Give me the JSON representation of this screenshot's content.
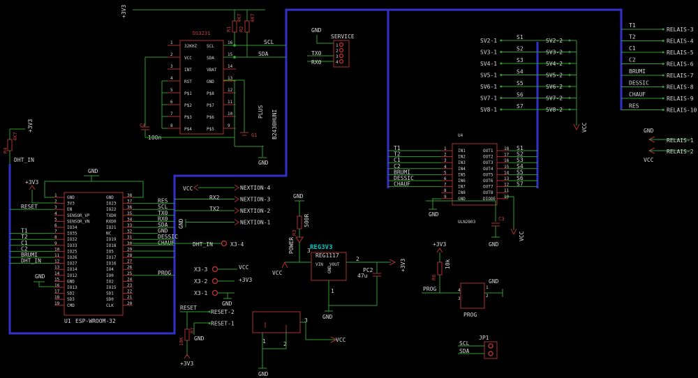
{
  "ds3231": {
    "ref": "DS3231",
    "left_pins": [
      {
        "num": "1",
        "name": "32KHZ"
      },
      {
        "num": "2",
        "name": "VCC"
      },
      {
        "num": "3",
        "name": "INT"
      },
      {
        "num": "4",
        "name": "RST"
      },
      {
        "num": "5",
        "name": "P$1"
      },
      {
        "num": "6",
        "name": "P$2"
      },
      {
        "num": "7",
        "name": "P$3"
      },
      {
        "num": "8",
        "name": "P$4"
      }
    ],
    "right_pins": [
      {
        "num": "16",
        "name": "SCL"
      },
      {
        "num": "15",
        "name": "SDA"
      },
      {
        "num": "14",
        "name": "VBAT"
      },
      {
        "num": "13",
        "name": "GND"
      },
      {
        "num": "12",
        "name": "P$8"
      },
      {
        "num": "11",
        "name": "P$7"
      },
      {
        "num": "10",
        "name": "P$6"
      },
      {
        "num": "9",
        "name": "P$5"
      }
    ]
  },
  "esp32": {
    "ref": "U1",
    "value": "ESP-WROOM-32",
    "left_pins": [
      {
        "num": "1",
        "name": "GND"
      },
      {
        "num": "2",
        "name": "3V3"
      },
      {
        "num": "3",
        "name": "EN"
      },
      {
        "num": "4",
        "name": "SENSOR_VP"
      },
      {
        "num": "5",
        "name": "SENSOR_VN"
      },
      {
        "num": "6",
        "name": "IO34"
      },
      {
        "num": "7",
        "name": "IO35"
      },
      {
        "num": "8",
        "name": "IO32"
      },
      {
        "num": "9",
        "name": "IO33"
      },
      {
        "num": "10",
        "name": "IO25"
      },
      {
        "num": "11",
        "name": "IO26"
      },
      {
        "num": "12",
        "name": "IO27"
      },
      {
        "num": "13",
        "name": "IO14"
      },
      {
        "num": "14",
        "name": "IO12"
      },
      {
        "num": "15",
        "name": "GND"
      },
      {
        "num": "16",
        "name": "IO13"
      },
      {
        "num": "17",
        "name": "SD2"
      },
      {
        "num": "18",
        "name": "SD3"
      },
      {
        "num": "19",
        "name": "CMD"
      }
    ],
    "right_pins": [
      {
        "num": "38",
        "name": "GND"
      },
      {
        "num": "37",
        "name": "IO23"
      },
      {
        "num": "36",
        "name": "IO22"
      },
      {
        "num": "35",
        "name": "TXD0"
      },
      {
        "num": "34",
        "name": "RXD0"
      },
      {
        "num": "33",
        "name": "IO21"
      },
      {
        "num": "32",
        "name": "NC"
      },
      {
        "num": "31",
        "name": "IO19"
      },
      {
        "num": "30",
        "name": "IO18"
      },
      {
        "num": "29",
        "name": "IO5"
      },
      {
        "num": "28",
        "name": "IO17"
      },
      {
        "num": "27",
        "name": "IO16"
      },
      {
        "num": "26",
        "name": "IO4"
      },
      {
        "num": "25",
        "name": "IO0"
      },
      {
        "num": "24",
        "name": "IO2"
      },
      {
        "num": "23",
        "name": "IO15"
      },
      {
        "num": "22",
        "name": "SD1"
      },
      {
        "num": "21",
        "name": "SD0"
      },
      {
        "num": "20",
        "name": "CLK"
      }
    ],
    "right_nets": [
      "",
      "RES",
      "SCL",
      "TX0",
      "RX0",
      "SDA",
      "GND",
      "DESSIC",
      "CHAUF",
      "",
      "",
      "",
      "",
      "PROG",
      "",
      "",
      "",
      "",
      ""
    ],
    "left_nets": [
      "",
      "",
      "RESET",
      "",
      "",
      "",
      "T1",
      "T2",
      "C1",
      "C2",
      "BRUMI",
      "DHT_IN",
      "",
      "",
      "",
      "",
      "",
      "",
      ""
    ]
  },
  "uln": {
    "ref": "U4",
    "value": "ULN2803",
    "left_pins": [
      {
        "num": "1",
        "name": "IN1"
      },
      {
        "num": "2",
        "name": "IN2"
      },
      {
        "num": "3",
        "name": "IN3"
      },
      {
        "num": "4",
        "name": "IN4"
      },
      {
        "num": "5",
        "name": "IN5"
      },
      {
        "num": "6",
        "name": "IN6"
      },
      {
        "num": "7",
        "name": "IN7"
      },
      {
        "num": "8",
        "name": "IN8"
      },
      {
        "num": "9",
        "name": "GND"
      }
    ],
    "right_pins": [
      {
        "num": "18",
        "name": "OUT1"
      },
      {
        "num": "17",
        "name": "OUT2"
      },
      {
        "num": "16",
        "name": "OUT3"
      },
      {
        "num": "15",
        "name": "OUT4"
      },
      {
        "num": "14",
        "name": "OUT5"
      },
      {
        "num": "13",
        "name": "OUT6"
      },
      {
        "num": "12",
        "name": "OUT7"
      },
      {
        "num": "11",
        "name": "OUT8"
      },
      {
        "num": "10",
        "name": "DIODE"
      }
    ],
    "in_nets": [
      "T1",
      "T2",
      "C1",
      "C2",
      "BRUMI",
      "DESSIC",
      "CHAUF"
    ],
    "out_nets": [
      "S1",
      "S2",
      "S3",
      "S4",
      "S5",
      "S6",
      "S7"
    ]
  },
  "sv_left": [
    "SV2-1",
    "SV3-1",
    "SV4-1",
    "SV5-1",
    "SV6-1",
    "SV7-1",
    "SV8-1"
  ],
  "sv_left_nets": [
    "S1",
    "S2",
    "S3",
    "S4",
    "S5",
    "S6",
    "S7"
  ],
  "sv_right": [
    "SV2-2",
    "SV3-2",
    "SV4-2",
    "SV5-2",
    "SV6-2",
    "SV7-2",
    "SV8-2"
  ],
  "relais_nets": [
    "T1",
    "T2",
    "C1",
    "C2",
    "BRUMI",
    "DESSIC",
    "CHAUF",
    "RES"
  ],
  "relais": [
    "RELAIS-3",
    "RELAIS-4",
    "RELAIS-5",
    "RELAIS-6",
    "RELAIS-7",
    "RELAIS-8",
    "RELAIS-9",
    "RELAIS-10"
  ],
  "relais_pwr": {
    "gnd": "GND",
    "r1": "RELAIS-1",
    "r2": "RELAIS-2",
    "vcc": "VCC"
  },
  "nextion": [
    "NEXTION-4",
    "NEXTION-3",
    "NEXTION-2",
    "NEXTION-1"
  ],
  "nextion_nets": {
    "vcc": "VCC",
    "rx": "RX2",
    "tx": "TX2",
    "gnd": "GND"
  },
  "x3": [
    "X3-4",
    "X3-3",
    "X3-2",
    "X3-1"
  ],
  "x3_nets": {
    "dht": "DHT_IN",
    "vcc": "VCC",
    "v33": "+3V3",
    "gnd": "GND"
  },
  "reset_conn": [
    "RESET-2",
    "RESET-1"
  ],
  "service": {
    "title": "SERVICE",
    "gnd": "GND",
    "tx": "TX0",
    "rx": "RX0"
  },
  "reg": {
    "ref": "REG3V3",
    "value": "REG1117",
    "vin": "VIN",
    "vout": "VOUT",
    "gnd": "GND",
    "pin1": "1",
    "pin2": "2",
    "pin3": "3"
  },
  "pc2": {
    "ref": "PC2",
    "value": "47u"
  },
  "r3": {
    "ref": "R3",
    "value": "500R",
    "led": "POWER"
  },
  "r6": {
    "ref": "R6",
    "value": "10k"
  },
  "r7": {
    "ref": "R7",
    "value": "10K"
  },
  "r4": {
    "ref": "R4",
    "value": "4K7"
  },
  "r1": {
    "ref": "R1",
    "value": "4K7"
  },
  "r2": {
    "ref": "R2",
    "value": "4K7"
  },
  "c3": {
    "ref": "C3"
  },
  "c4": {
    "ref": "C4",
    "value": "100n"
  },
  "g1": {
    "ref": "G1",
    "value": "B2430HUNI",
    "plus": "PLUS",
    "minus": "-"
  },
  "prog": {
    "label": "PROG",
    "net": "PROG",
    "p1": "1",
    "p2": "2",
    "p3": "3",
    "p4": "4"
  },
  "jp1": {
    "ref": "JP1",
    "scl": "SCL",
    "sda": "SDA"
  },
  "labels": {
    "v33": "+3V3",
    "gnd": "GND",
    "vcc": "VCC",
    "scl": "SCL",
    "sda": "SDA",
    "dht": "DHT_IN",
    "reset": "RESET",
    "prog": "PROG",
    "res": "RES",
    "pin1": "1",
    "pin2": "2",
    "pin3": "3"
  }
}
